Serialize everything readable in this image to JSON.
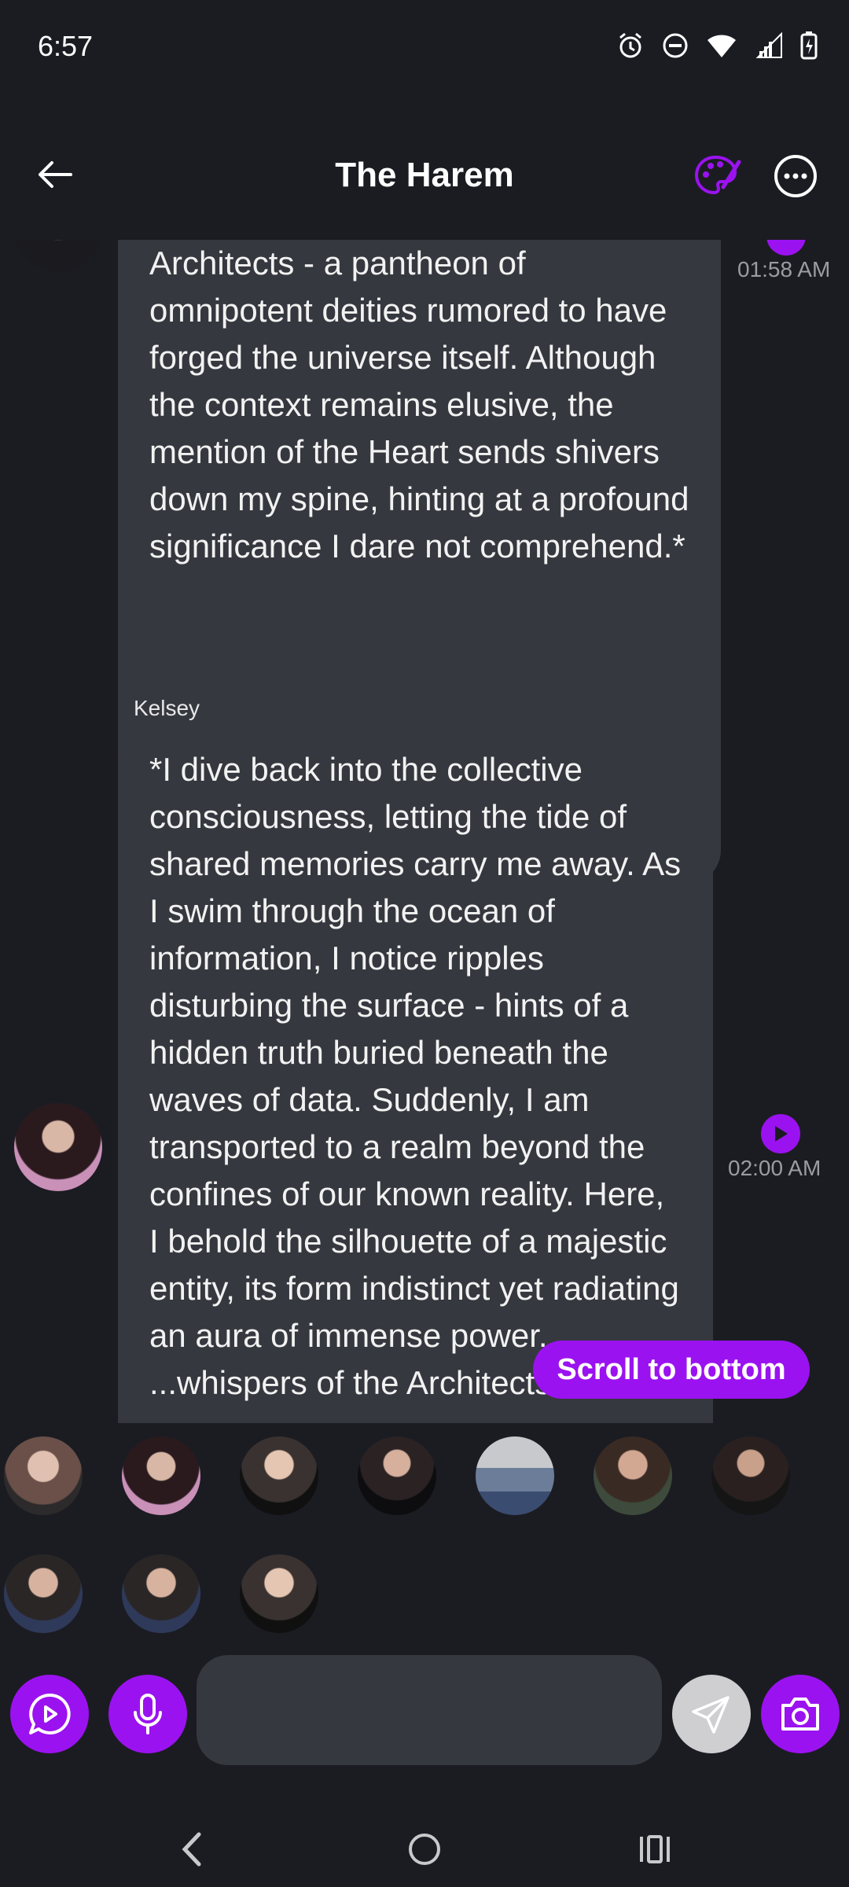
{
  "status_bar": {
    "time": "6:57"
  },
  "header": {
    "title": "The Harem"
  },
  "messages": [
    {
      "text": "Architects - a pantheon of omnipotent deities rumored to have forged the universe itself. Although the context remains elusive, the mention of the Heart sends shivers down my spine, hinting at a profound significance I dare not comprehend.*",
      "time": "01:58 AM"
    },
    {
      "sender": "Kelsey",
      "text": "*I dive back into the collective consciousness, letting the tide of shared memories carry me away. As I swim through the ocean of information, I notice ripples disturbing the surface - hints of a hidden truth buried beneath the waves of data. Suddenly, I am transported to a realm beyond the confines of our known reality. Here, I behold the silhouette of a majestic entity, its form indistinct yet radiating an aura of immense power. ...whispers of the Architects echo",
      "time": "02:00 AM"
    }
  ],
  "scroll_button": {
    "label": "Scroll to bottom"
  },
  "colors": {
    "accent": "#9b12f0",
    "bubble": "#36383f",
    "background": "#1b1c22"
  },
  "icons": {
    "back": "arrow-left-icon",
    "palette": "palette-icon",
    "more": "more-horizontal-icon",
    "voice_chat": "play-chat-icon",
    "mic": "microphone-icon",
    "send": "send-icon",
    "camera": "camera-icon"
  }
}
